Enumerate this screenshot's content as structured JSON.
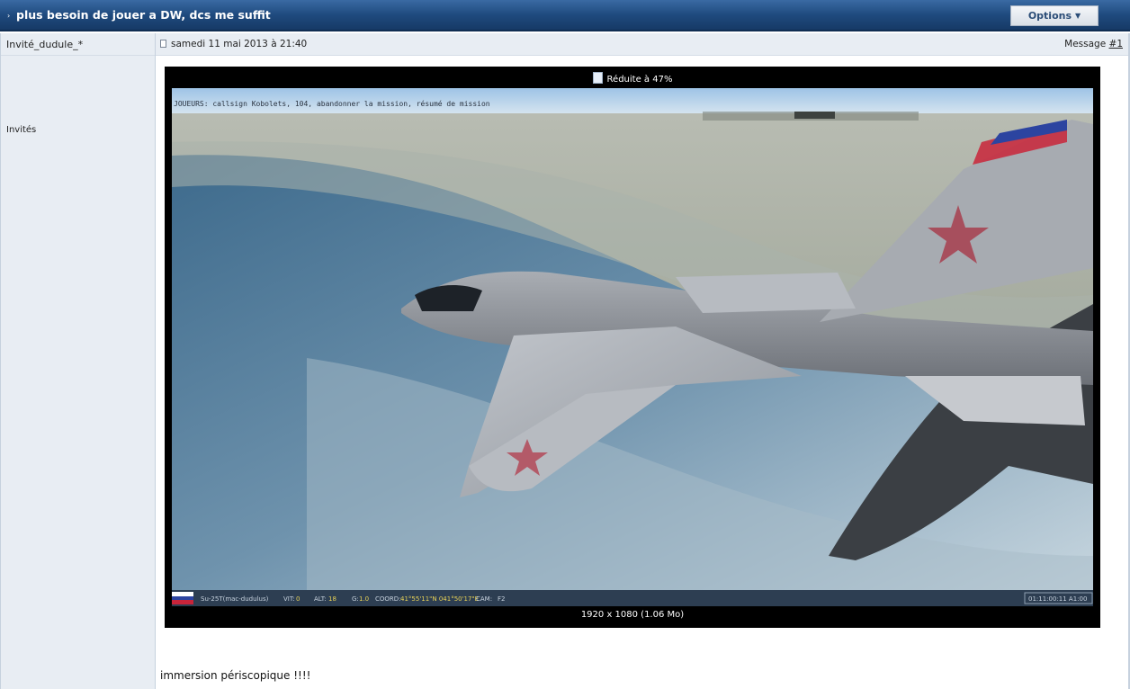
{
  "topic": {
    "arrow": "›",
    "title": "plus besoin de jouer a DW, dcs me suffit",
    "options_label": "Options",
    "options_caret": "▼"
  },
  "post": {
    "author": "Invité_dudule_*",
    "group": "Invités",
    "date": "samedi 11 mai 2013 à 21:40",
    "message_label": "Message",
    "message_number": "#1",
    "text": "immersion périscopique !!!!"
  },
  "image": {
    "resize_notice": "Réduite à 47%",
    "caption": "1920 x 1080 (1.06 Mo)",
    "game_top_text": "JOUEURS: callsign Kobolets, 104, abandonner la mission, résumé de mission",
    "hud": {
      "aircraft": "Su-25T(mac-dudulus)",
      "vit_label": "VIT:",
      "vit_value": "0",
      "alt_label": "ALT:",
      "alt_value": "18",
      "g_label": "G:",
      "g_value": "1.0",
      "coord_label": "COORD:",
      "coord_value": "41°55'11\"N 041°50'17\"E",
      "cam_label": "CAM:",
      "cam_value": "F2",
      "time": "01:11:00:11 A1:00"
    }
  }
}
